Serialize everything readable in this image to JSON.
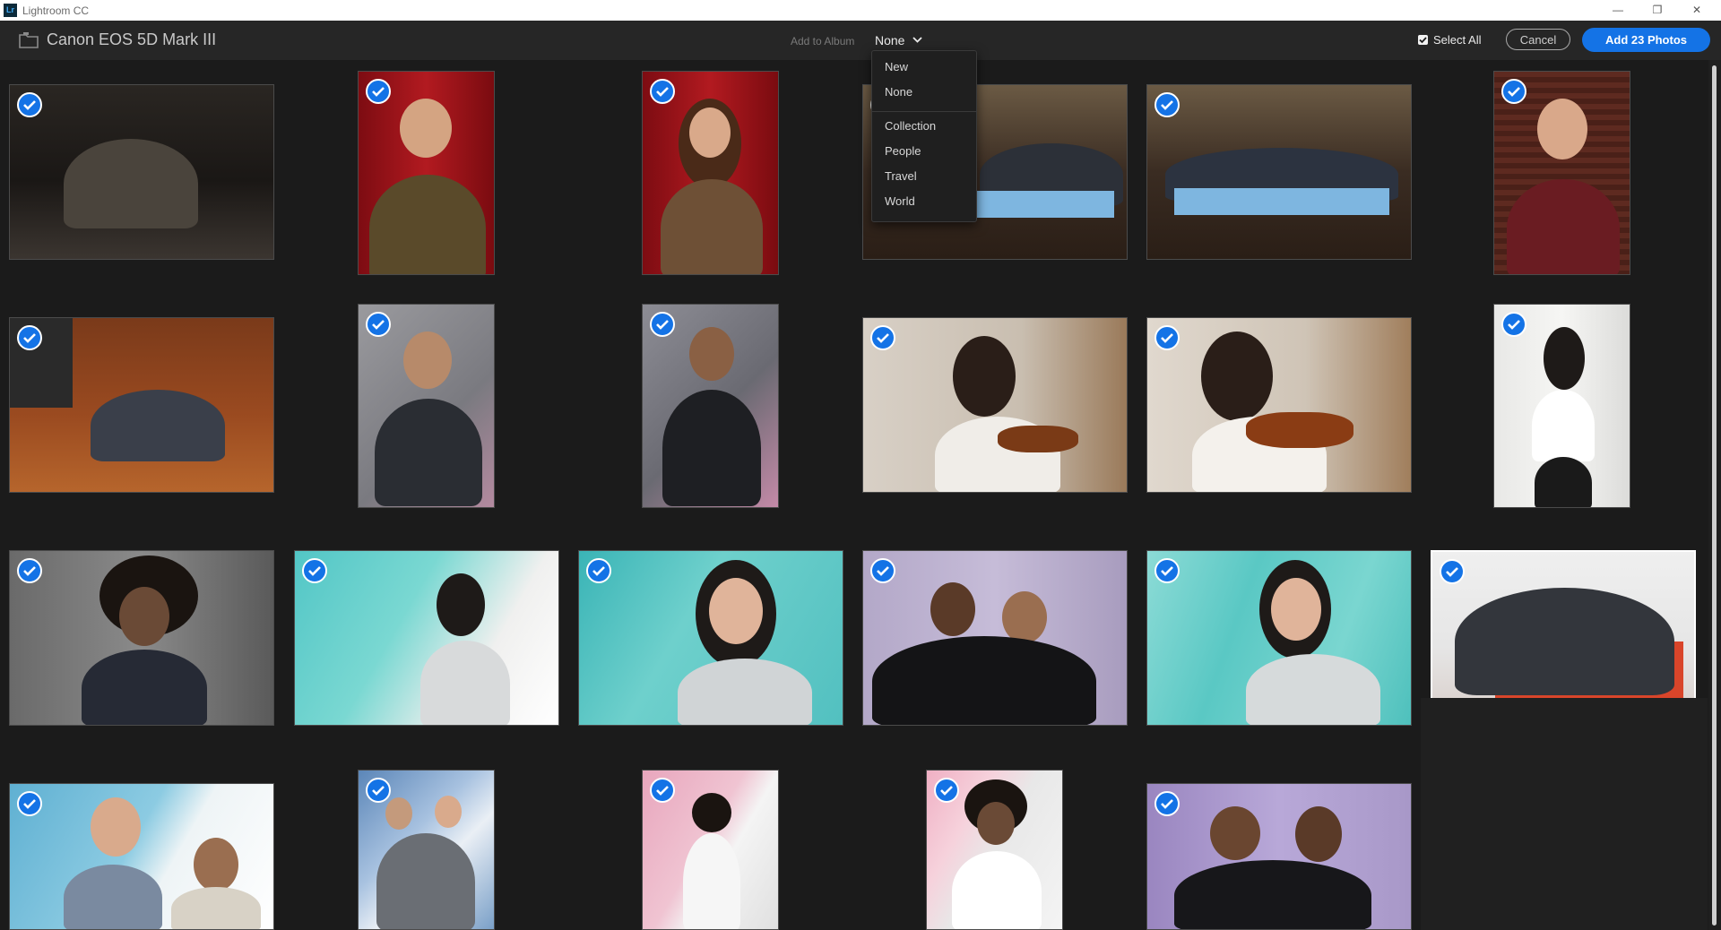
{
  "window": {
    "app_title": "Lightroom CC",
    "logo_text": "Lr",
    "min": "—",
    "restore": "❐",
    "close": "✕"
  },
  "header": {
    "device_title": "Canon EOS 5D Mark III",
    "album_label": "Add to Album",
    "album_selected": "None",
    "select_all_label": "Select All",
    "cancel_label": "Cancel",
    "add_label": "Add 23 Photos"
  },
  "dropdown": {
    "items": [
      "New",
      "None",
      "Collection",
      "People",
      "Travel",
      "World"
    ]
  },
  "photos": [
    {
      "name": "photo-group-night-street",
      "selected": true
    },
    {
      "name": "photo-man-hat-red-curtain",
      "selected": true
    },
    {
      "name": "photo-woman-red-curtain",
      "selected": true
    },
    {
      "name": "photo-band-diner-1",
      "selected": true
    },
    {
      "name": "photo-band-diner-2",
      "selected": true
    },
    {
      "name": "photo-man-wood-wall",
      "selected": true
    },
    {
      "name": "photo-two-men-studio",
      "selected": true
    },
    {
      "name": "photo-man-cap-graffiti",
      "selected": true
    },
    {
      "name": "photo-man-hat-graffiti",
      "selected": true
    },
    {
      "name": "photo-violinist-1",
      "selected": true
    },
    {
      "name": "photo-violinist-2",
      "selected": true
    },
    {
      "name": "photo-woman-white-wall",
      "selected": true
    },
    {
      "name": "photo-man-afro-laughing",
      "selected": true
    },
    {
      "name": "photo-woman-teal-1",
      "selected": true
    },
    {
      "name": "photo-woman-teal-2",
      "selected": true
    },
    {
      "name": "photo-two-men-purple",
      "selected": true
    },
    {
      "name": "photo-woman-teal-3",
      "selected": true
    },
    {
      "name": "photo-band-red-backdrop",
      "selected": true
    },
    {
      "name": "photo-two-men-blue",
      "selected": true
    },
    {
      "name": "photo-two-men-geometric",
      "selected": true
    },
    {
      "name": "photo-dancer-pink",
      "selected": true
    },
    {
      "name": "photo-man-afro-white",
      "selected": true
    },
    {
      "name": "photo-two-men-purple-2",
      "selected": true
    }
  ]
}
